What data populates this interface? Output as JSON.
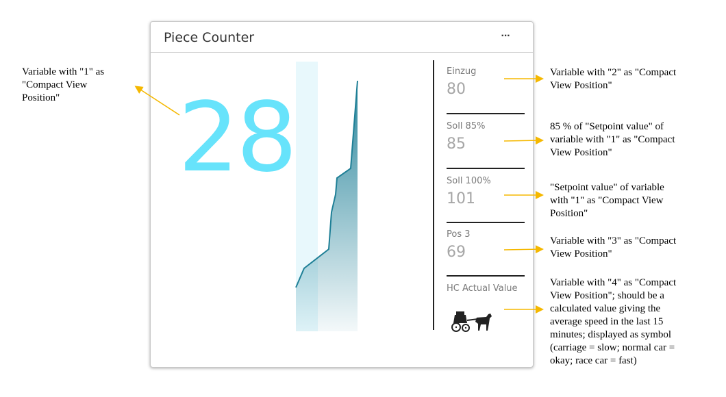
{
  "card": {
    "title": "Piece Counter",
    "menu_label": "···",
    "main_value": "28",
    "stats": [
      {
        "label": "Einzug",
        "value": "80"
      },
      {
        "label": "Soll 85%",
        "value": "85"
      },
      {
        "label": "Soll 100%",
        "value": "101"
      },
      {
        "label": "Pos 3",
        "value": "69"
      },
      {
        "label": "HC Actual Value",
        "icon": "horse-carriage-icon"
      }
    ],
    "colors": {
      "main_value": "#67e3fb",
      "sparkline": "#1e7f96",
      "arrow": "#f5b800"
    }
  },
  "annotations": {
    "left": "Variable with \"1\" as\n\"Compact View\nPosition\"",
    "einzug": "Variable with \"2\" as \"Compact\nView Position\"",
    "soll85": "85 % of \"Setpoint value\" of\nvariable with \"1\" as \"Compact\nView Position\"",
    "soll100": "\"Setpoint value\" of variable\nwith \"1\" as \"Compact View\nPosition\"",
    "pos3": "Variable with \"3\" as \"Compact\nView Position\"",
    "hc": "Variable with \"4\" as \"Compact\nView Position\"; should be a\ncalculated value giving the\naverage speed in the last 15\nminutes; displayed as symbol\n(carriage = slow; normal car =\nokay; race car = fast)"
  }
}
